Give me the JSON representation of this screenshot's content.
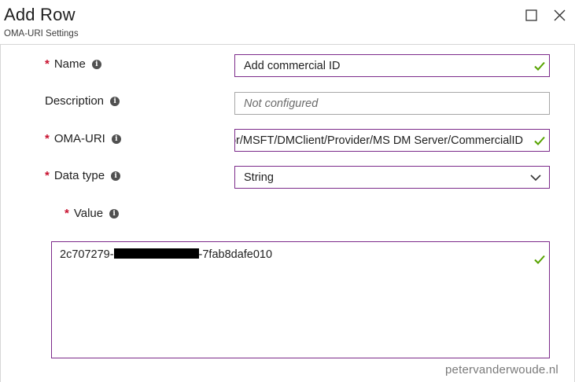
{
  "header": {
    "title": "Add Row",
    "subtitle": "OMA-URI Settings"
  },
  "form": {
    "name": {
      "label": "Name",
      "required": "*",
      "info": "i",
      "value": "Add commercial ID"
    },
    "description": {
      "label": "Description",
      "info": "i",
      "placeholder": "Not configured"
    },
    "oma_uri": {
      "label": "OMA-URI",
      "required": "*",
      "info": "i",
      "value": "./Vendor/MSFT/DMClient/Provider/MS DM Server/CommercialID"
    },
    "data_type": {
      "label": "Data type",
      "required": "*",
      "info": "i",
      "selected": "String"
    },
    "value": {
      "label": "Value",
      "required": "*",
      "info": "i",
      "prefix": "2c707279-",
      "suffix": "-7fab8dafe010"
    }
  },
  "watermark": "petervanderwoude.nl",
  "colors": {
    "field_border_focus": "#7c2a8a",
    "field_border_default": "#a6a6a6",
    "required": "#c8102e",
    "valid_check": "#57a300"
  }
}
